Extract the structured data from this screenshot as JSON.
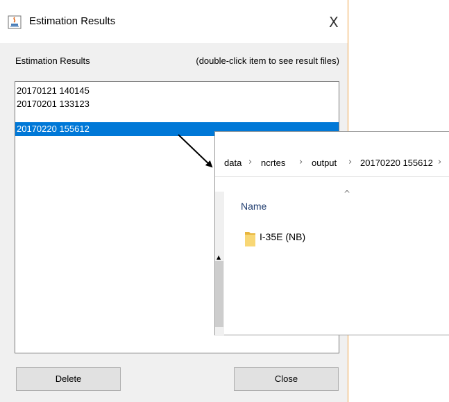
{
  "dialog": {
    "title": "Estimation Results",
    "close_glyph": "X",
    "section_label": "Estimation Results",
    "hint": "(double-click item to see result files)",
    "items": [
      {
        "label": "20170121 140145",
        "selected": false
      },
      {
        "label": "20170201 133123",
        "selected": false
      },
      {
        "label": "20170220 155612",
        "selected": true
      }
    ],
    "delete_label": "Delete",
    "close_label": "Close",
    "selection_color": "#0078d7"
  },
  "explorer": {
    "breadcrumb": [
      "data",
      "ncrtes",
      "output",
      "20170220 155612"
    ],
    "breadcrumb_separator": "›",
    "column_header": "Name",
    "items": [
      {
        "name": "I-35E (NB)",
        "icon": "folder-icon"
      }
    ]
  }
}
